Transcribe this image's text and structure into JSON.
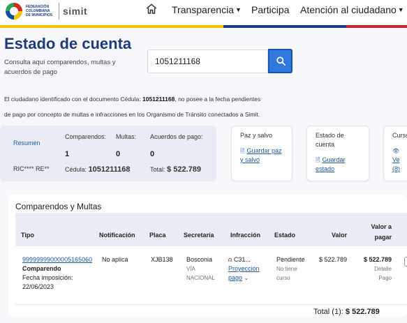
{
  "header": {
    "federation_text": "FEDERACIÓN COLOMBIANA DE MUNICIPIOS",
    "brand": "simit",
    "nav": [
      {
        "label": "Transparencia",
        "dropdown": true
      },
      {
        "label": "Participa",
        "dropdown": false
      },
      {
        "label": "Atención al ciudadano",
        "dropdown": true
      }
    ],
    "flag_colors": [
      "#f2c500",
      "#1e3c8c",
      "#c0262d"
    ]
  },
  "page": {
    "title": "Estado de cuenta",
    "subtitle": "Consulta aquí comparendos, multas y acuerdos de pago",
    "search_value": "1051211168",
    "accent": "#2f79de"
  },
  "message": {
    "part1": "El ciudadano identificado con el documento Cédula: ",
    "document": "1051211168",
    "part2": ", no posee a la fecha pendientes",
    "line2": "de pago por concepto de multas e infracciones en los Organismo de Tránsito conectados a Simit."
  },
  "summary": {
    "resumen_label": "Resumen",
    "name": "RIC**** RE**",
    "comparendos_label": "Comparendos:",
    "comparendos_value": "1",
    "multas_label": "Multas:",
    "multas_value": "0",
    "acuerdos_label": "Acuerdos de pago:",
    "acuerdos_value": "0",
    "cedula_label": "Cédula:",
    "cedula_value": "1051211168",
    "total_label": "Total:",
    "total_value": "$ 522.789"
  },
  "cards": [
    {
      "title1": "Paz y salvo",
      "title2": "",
      "link1": "Guardar paz",
      "link2": "y salvo"
    },
    {
      "title1": "Estado de",
      "title2": "cuenta",
      "link1": "Guardar",
      "link2": "estado"
    },
    {
      "title1": "Curso",
      "title2": "",
      "link1": "Ve",
      "link2": "(8)"
    }
  ],
  "table": {
    "section_title": "Comparendos y Multas",
    "headers": {
      "tipo": "Tipo",
      "notificacion": "Notificación",
      "placa": "Placa",
      "secretaria": "Secretaría",
      "infraccion": "Infracción",
      "estado": "Estado",
      "valor": "Valor",
      "valor_pagar_1": "Valor a",
      "valor_pagar_2": "pagar"
    },
    "row": {
      "numero": "99999999000005165060",
      "tipo": "Comparendo",
      "fecha_label": "Fecha imposición:",
      "fecha": "22/06/2023",
      "notificacion": "No aplica",
      "placa": "XJB138",
      "secretaria": "Bosconia",
      "secretaria_sub1": "VÍA",
      "secretaria_sub2": "NACIONAL",
      "infraccion": "C31...",
      "proyeccion1": "Proyección",
      "proyeccion2": "pago",
      "estado": "Pendiente",
      "estado_sub1": "No tiene",
      "estado_sub2": "curso",
      "valor": "$ 522.789",
      "valor_pagar": "$ 522.789",
      "detalle1": "Detalle",
      "detalle2": "Pago"
    },
    "total_label": "Total (1):",
    "total_value": "$ 522.789"
  }
}
